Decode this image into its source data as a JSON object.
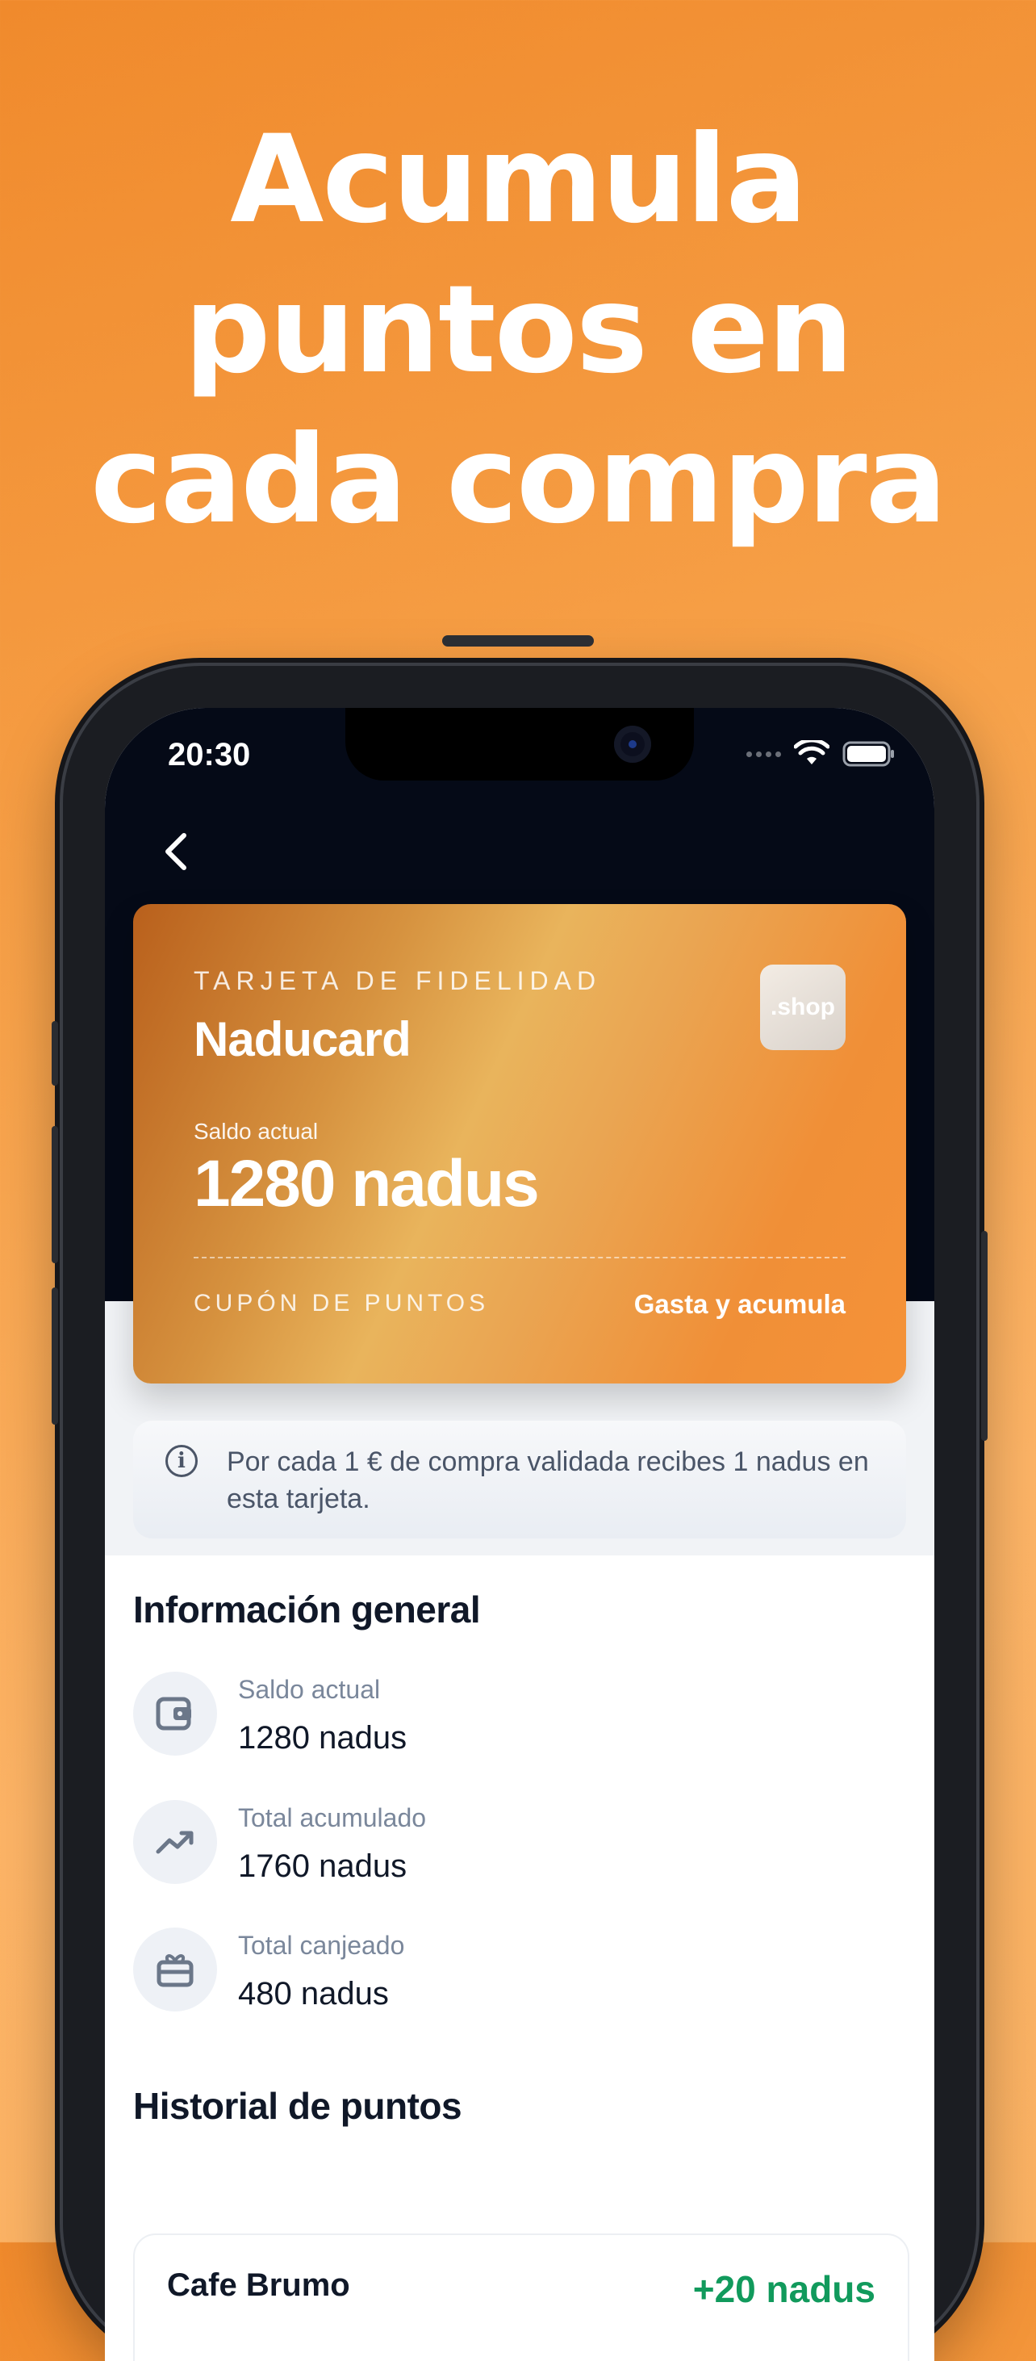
{
  "headline": {
    "line1": "Acumula",
    "line2": "puntos en",
    "line3": "cada compra"
  },
  "status_bar": {
    "time": "20:30"
  },
  "card": {
    "kicker": "TARJETA DE FIDELIDAD",
    "name": "Naducard",
    "brand_badge": ".shop",
    "balance_label": "Saldo actual",
    "balance": "1280 nadus",
    "coupon_label": "CUPÓN DE PUNTOS",
    "cta": "Gasta y acumula"
  },
  "info": {
    "text": "Por cada 1 € de compra validada recibes 1 nadus en esta tarjeta."
  },
  "general": {
    "title": "Información general",
    "stats": [
      {
        "label": "Saldo actual",
        "value": "1280 nadus",
        "icon": "wallet-icon"
      },
      {
        "label": "Total acumulado",
        "value": "1760 nadus",
        "icon": "trend-up-icon"
      },
      {
        "label": "Total canjeado",
        "value": "480 nadus",
        "icon": "gift-icon"
      }
    ]
  },
  "history": {
    "title": "Historial de puntos",
    "items": [
      {
        "merchant": "Cafe Brumo",
        "points": "+20 nadus"
      }
    ]
  },
  "colors": {
    "accent": "#f59238",
    "positive": "#119a5c",
    "dark_header": "#050a17"
  }
}
